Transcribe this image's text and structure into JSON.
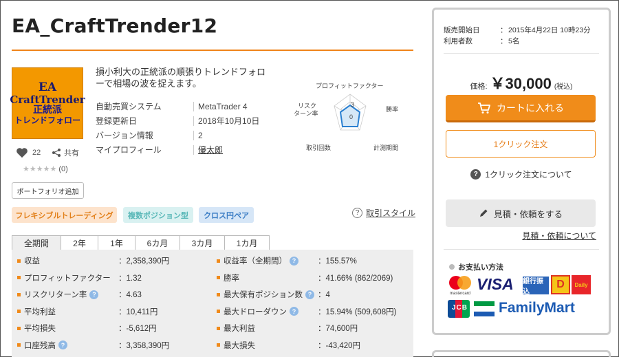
{
  "title": "EA_CraftTrender12",
  "product_image": {
    "line1": "EA",
    "line2": "CraftTrender",
    "line3": "正統派",
    "line4": "トレンドフォロー"
  },
  "likes": {
    "count": "22",
    "share_label": "共有"
  },
  "rating": {
    "stars": "★★★★★",
    "count": "(0)"
  },
  "portfolio_button": "ポートフォリオ追加",
  "description": "損小利大の正統派の順張りトレンドフォローで相場の波を捉えます。",
  "info": [
    {
      "label": "自動売買システム",
      "value": "MetaTrader 4",
      "link": false
    },
    {
      "label": "登録更新日",
      "value": "2018年10月10日",
      "link": false
    },
    {
      "label": "バージョン情報",
      "value": "2",
      "link": false
    },
    {
      "label": "マイプロフィール",
      "value": "優太郎",
      "link": true
    }
  ],
  "radar": {
    "labels": [
      "プロフィットファクター",
      "勝率",
      "計測期間",
      "取引回数",
      "リスク\nターン率"
    ],
    "scale_max": "3",
    "scale_min": "0"
  },
  "tags": [
    "フレキシブルトレーディング",
    "複数ポジション型",
    "クロス円ペア"
  ],
  "trade_style_link": "取引スタイル",
  "tabs": [
    "全期間",
    "2年",
    "1年",
    "6カ月",
    "3カ月",
    "1カ月"
  ],
  "stats_left": [
    {
      "label": "収益",
      "value": "：2,358,390円",
      "help": false
    },
    {
      "label": "プロフィットファクター",
      "value": "：1.32",
      "help": false
    },
    {
      "label": "リスクリターン率",
      "value": "：4.63",
      "help": true
    },
    {
      "label": "平均利益",
      "value": "：10,411円",
      "help": false
    },
    {
      "label": "平均損失",
      "value": "：-5,612円",
      "help": false
    },
    {
      "label": "口座残高",
      "value": "：3,358,390円",
      "help": true
    }
  ],
  "stats_right": [
    {
      "label": "収益率（全期間）",
      "value": "：155.57%",
      "help": true
    },
    {
      "label": "勝率",
      "value": "：41.66% (862/2069)",
      "help": false
    },
    {
      "label": "最大保有ポジション数",
      "value": "：4",
      "help": true
    },
    {
      "label": "最大ドローダウン",
      "value": "：15.94% (509,608円)",
      "help": true
    },
    {
      "label": "最大利益",
      "value": "：74,600円",
      "help": false
    },
    {
      "label": "最大損失",
      "value": "：-43,420円",
      "help": false
    }
  ],
  "side": {
    "release_label": "販売開始日",
    "release_value": "2015年4月22日 10時23分",
    "users_label": "利用者数",
    "users_value": "5名",
    "price_label": "価格:",
    "price_value": "￥30,000",
    "price_tax": "(税込)",
    "cart_button": "カートに入れる",
    "oneclick_button": "1クリック注文",
    "about_oneclick": "1クリック注文について",
    "quote_button": "見積・依頼をする",
    "about_quote": "見積・依頼について",
    "payment_title": "お支払い方法",
    "payment_methods": [
      "mastercard",
      "VISA",
      "銀行振込",
      "D",
      "Daily",
      "JCB",
      "FamilyMart"
    ]
  },
  "colors": {
    "accent": "#f08c1a",
    "rule": "#f0841a",
    "stats_bg": "#eeeeee"
  }
}
